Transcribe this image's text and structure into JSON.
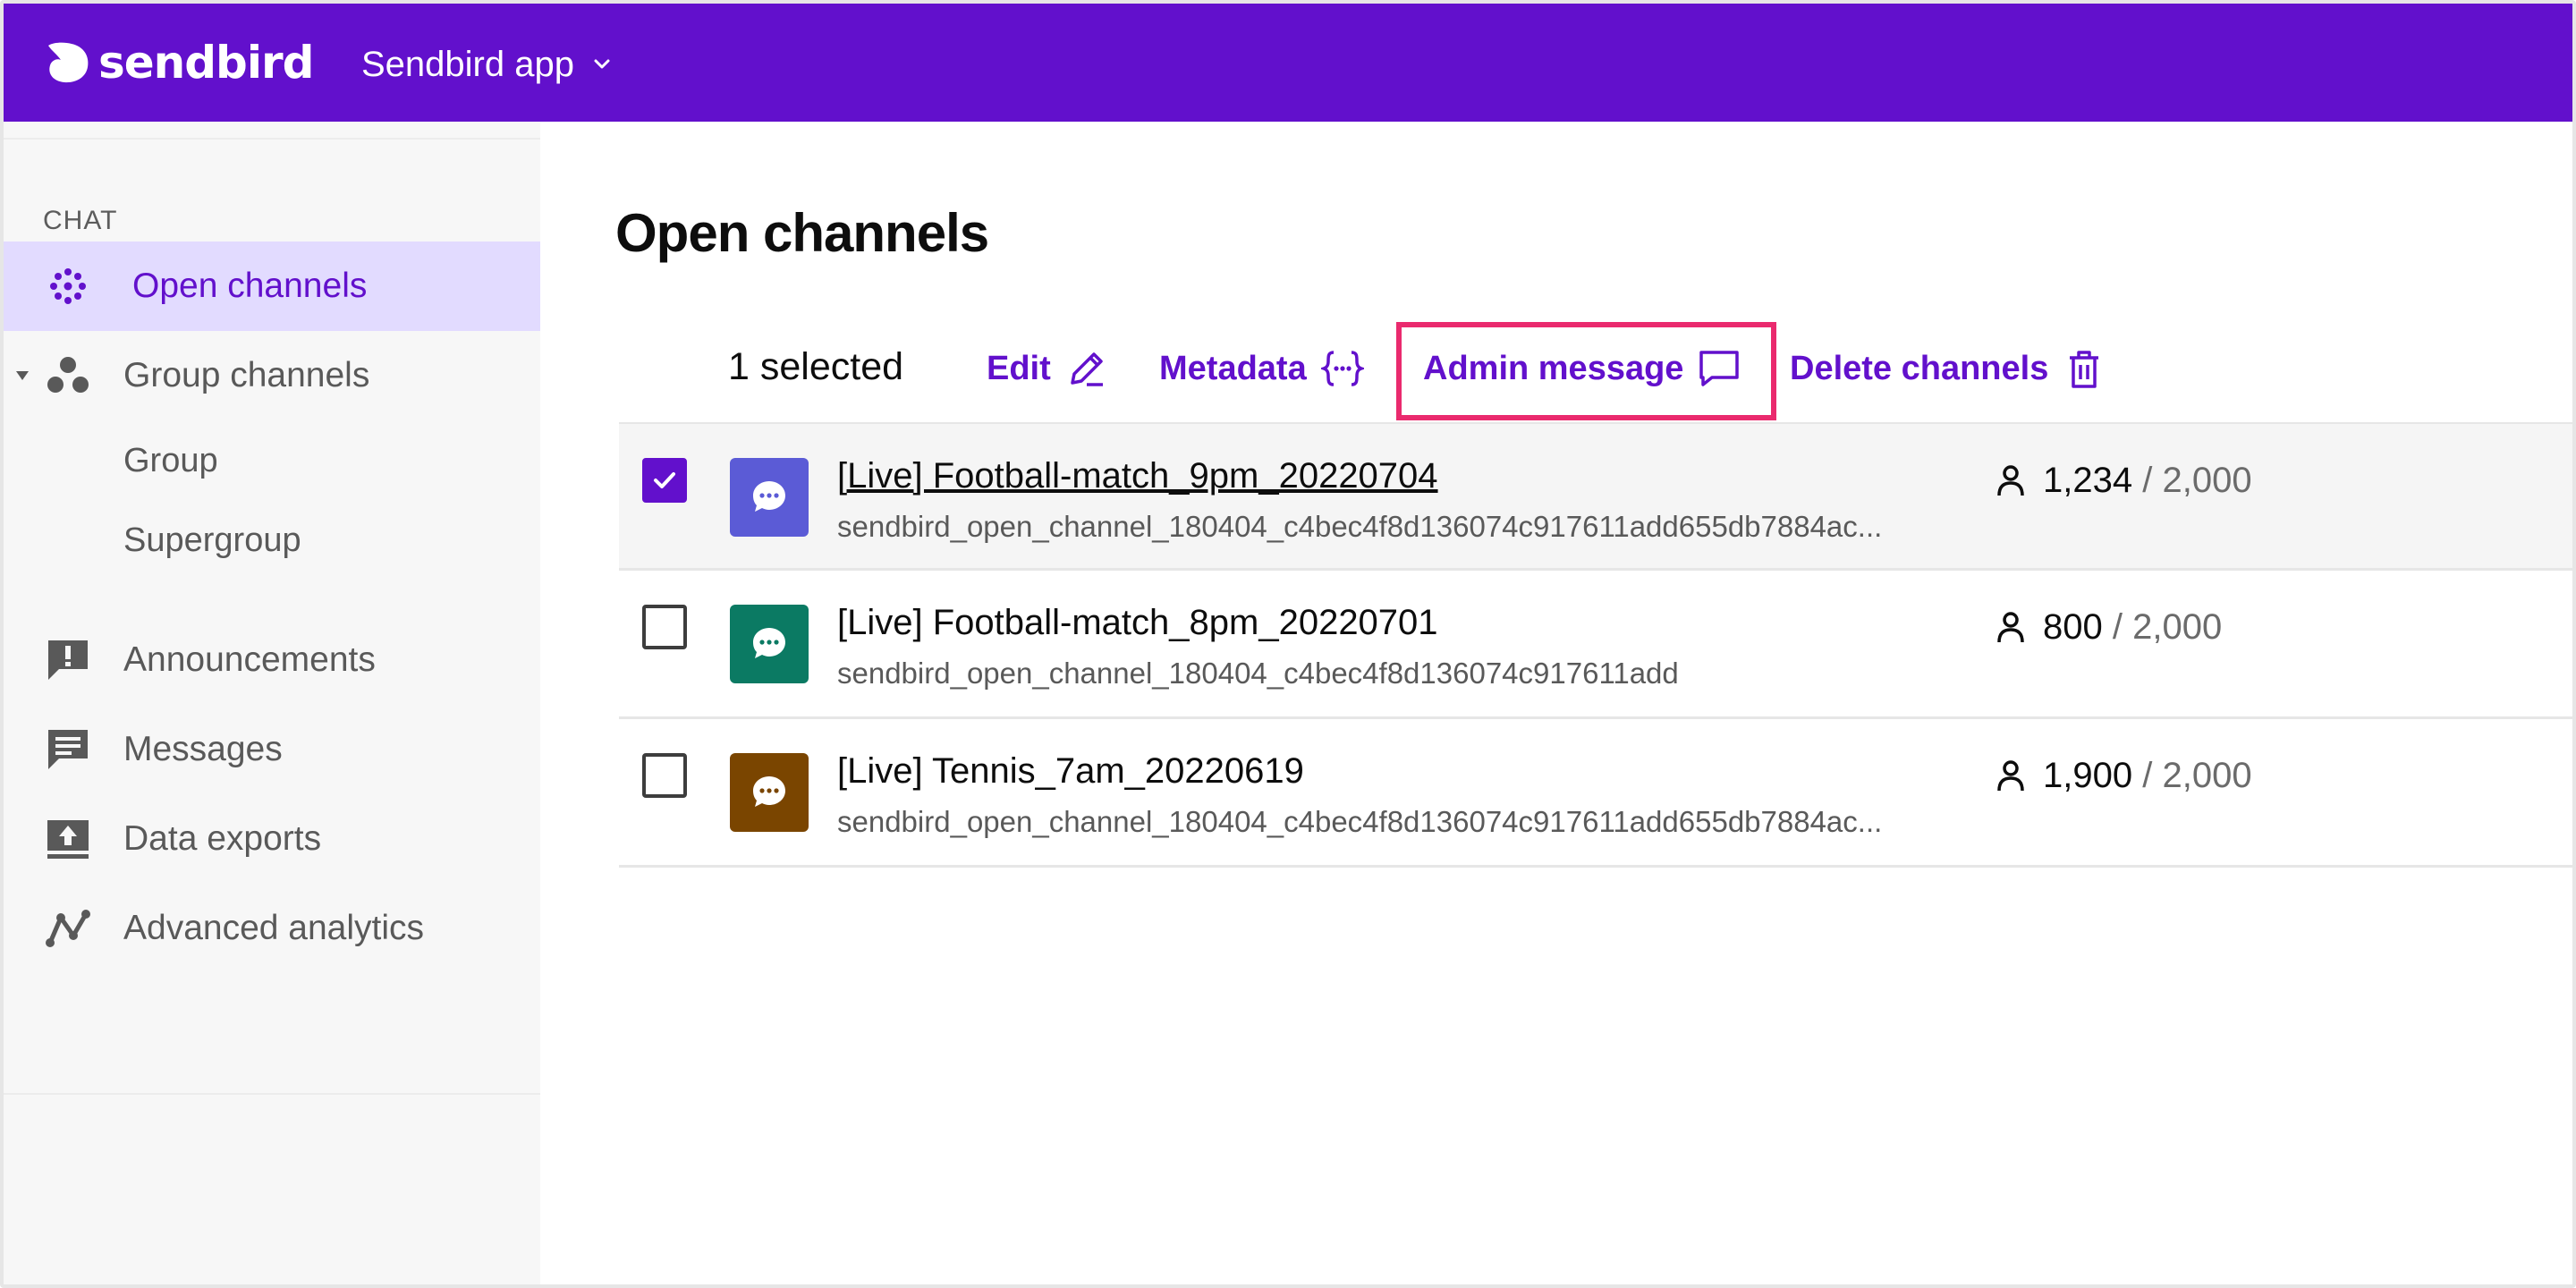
{
  "header": {
    "logo_text": "sendbird",
    "app_name": "Sendbird app",
    "bg_color": "#6210CC"
  },
  "sidebar": {
    "section": "CHAT",
    "items": [
      {
        "label": "Open channels",
        "icon": "open-channels-icon",
        "active": true
      },
      {
        "label": "Group channels",
        "icon": "group-channels-icon",
        "expanded": true,
        "children": [
          {
            "label": "Group"
          },
          {
            "label": "Supergroup"
          }
        ]
      },
      {
        "label": "Announcements",
        "icon": "announcements-icon"
      },
      {
        "label": "Messages",
        "icon": "messages-icon"
      },
      {
        "label": "Data exports",
        "icon": "data-exports-icon"
      },
      {
        "label": "Advanced analytics",
        "icon": "analytics-icon"
      }
    ]
  },
  "main": {
    "title": "Open channels",
    "toolbar": {
      "selected_label": "1 selected",
      "actions": [
        {
          "label": "Edit",
          "icon": "pencil-icon"
        },
        {
          "label": "Metadata",
          "icon": "metadata-braces-icon"
        },
        {
          "label": "Admin message",
          "icon": "chat-bubble-icon",
          "highlighted": true
        },
        {
          "label": "Delete channels",
          "icon": "trash-icon"
        }
      ]
    },
    "rows": [
      {
        "name": "[Live] Football-match_9pm_20220704",
        "url": "sendbird_open_channel_180404_c4bec4f8d136074c917611add655db7884ac...",
        "members": "1,234",
        "capacity": "/ 2,000",
        "selected": true,
        "avatar_color": "#5B5BD6"
      },
      {
        "name": "[Live] Football-match_8pm_20220701",
        "url": "sendbird_open_channel_180404_c4bec4f8d136074c917611add",
        "members": "800",
        "capacity": "/ 2,000",
        "selected": false,
        "avatar_color": "#0B7A63"
      },
      {
        "name": "[Live] Tennis_7am_20220619",
        "url": "sendbird_open_channel_180404_c4bec4f8d136074c917611add655db7884ac...",
        "members": "1,900",
        "capacity": "/ 2,000",
        "selected": false,
        "avatar_color": "#7A4500"
      }
    ]
  },
  "colors": {
    "accent": "#6210CC",
    "highlight_border": "#EA2A6E",
    "active_nav_bg": "#E2DBFF"
  }
}
